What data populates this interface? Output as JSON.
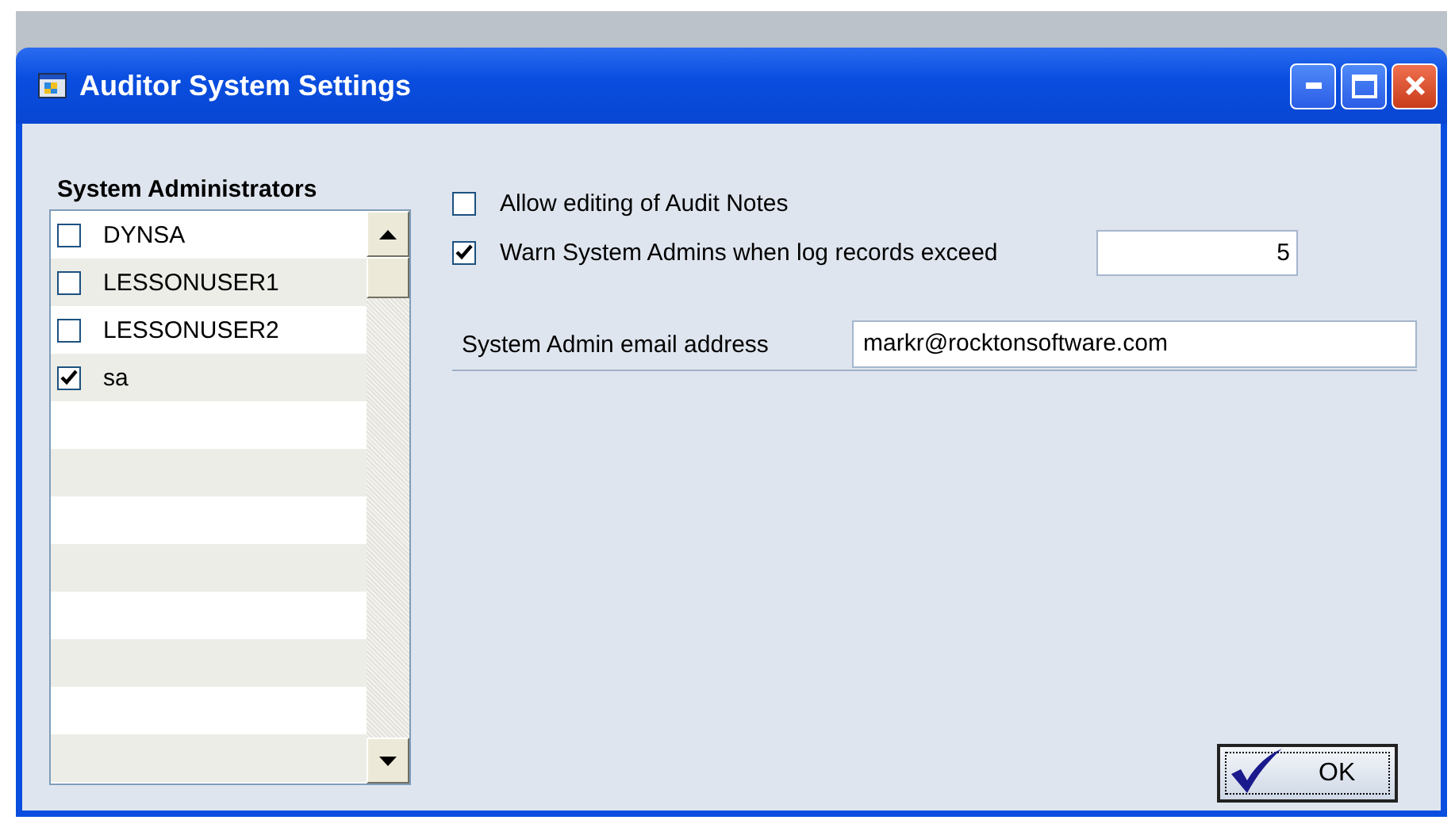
{
  "window": {
    "title": "Auditor System Settings"
  },
  "administrators": {
    "heading": "System Administrators",
    "items": [
      {
        "name": "DYNSA",
        "checked": false
      },
      {
        "name": "LESSONUSER1",
        "checked": false
      },
      {
        "name": "LESSONUSER2",
        "checked": false
      },
      {
        "name": "sa",
        "checked": true
      }
    ]
  },
  "options": [
    {
      "label": "Allow editing of Audit Notes",
      "checked": false
    },
    {
      "label": "Warn System Admins when log records exceed",
      "checked": true,
      "value": "5"
    }
  ],
  "email": {
    "label": "System Admin email address",
    "value": "markr@rocktonsoftware.com"
  },
  "buttons": [
    {
      "label": "OK"
    }
  ]
}
